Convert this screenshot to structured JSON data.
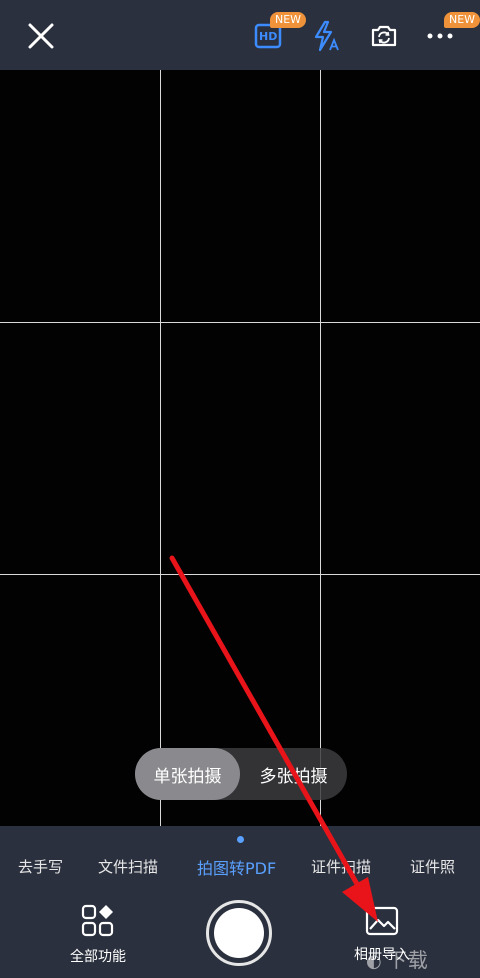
{
  "header": {
    "hd_badge": "NEW",
    "hd_label": "HD",
    "more_badge": "NEW"
  },
  "mode": {
    "single": "单张拍摄",
    "multi": "多张拍摄"
  },
  "tabs": [
    {
      "label": "去手写"
    },
    {
      "label": "文件扫描"
    },
    {
      "label": "拍图转PDF"
    },
    {
      "label": "证件扫描"
    },
    {
      "label": "证件照"
    }
  ],
  "active_tab_index": 2,
  "tools": {
    "all_features": "全部功能",
    "album_import": "相册导入"
  },
  "watermark": "下载",
  "colors": {
    "accent": "#5aa0ff",
    "badge": "#f0923a",
    "bar": "#2a303d",
    "annotation_arrow": "#e8141a"
  }
}
